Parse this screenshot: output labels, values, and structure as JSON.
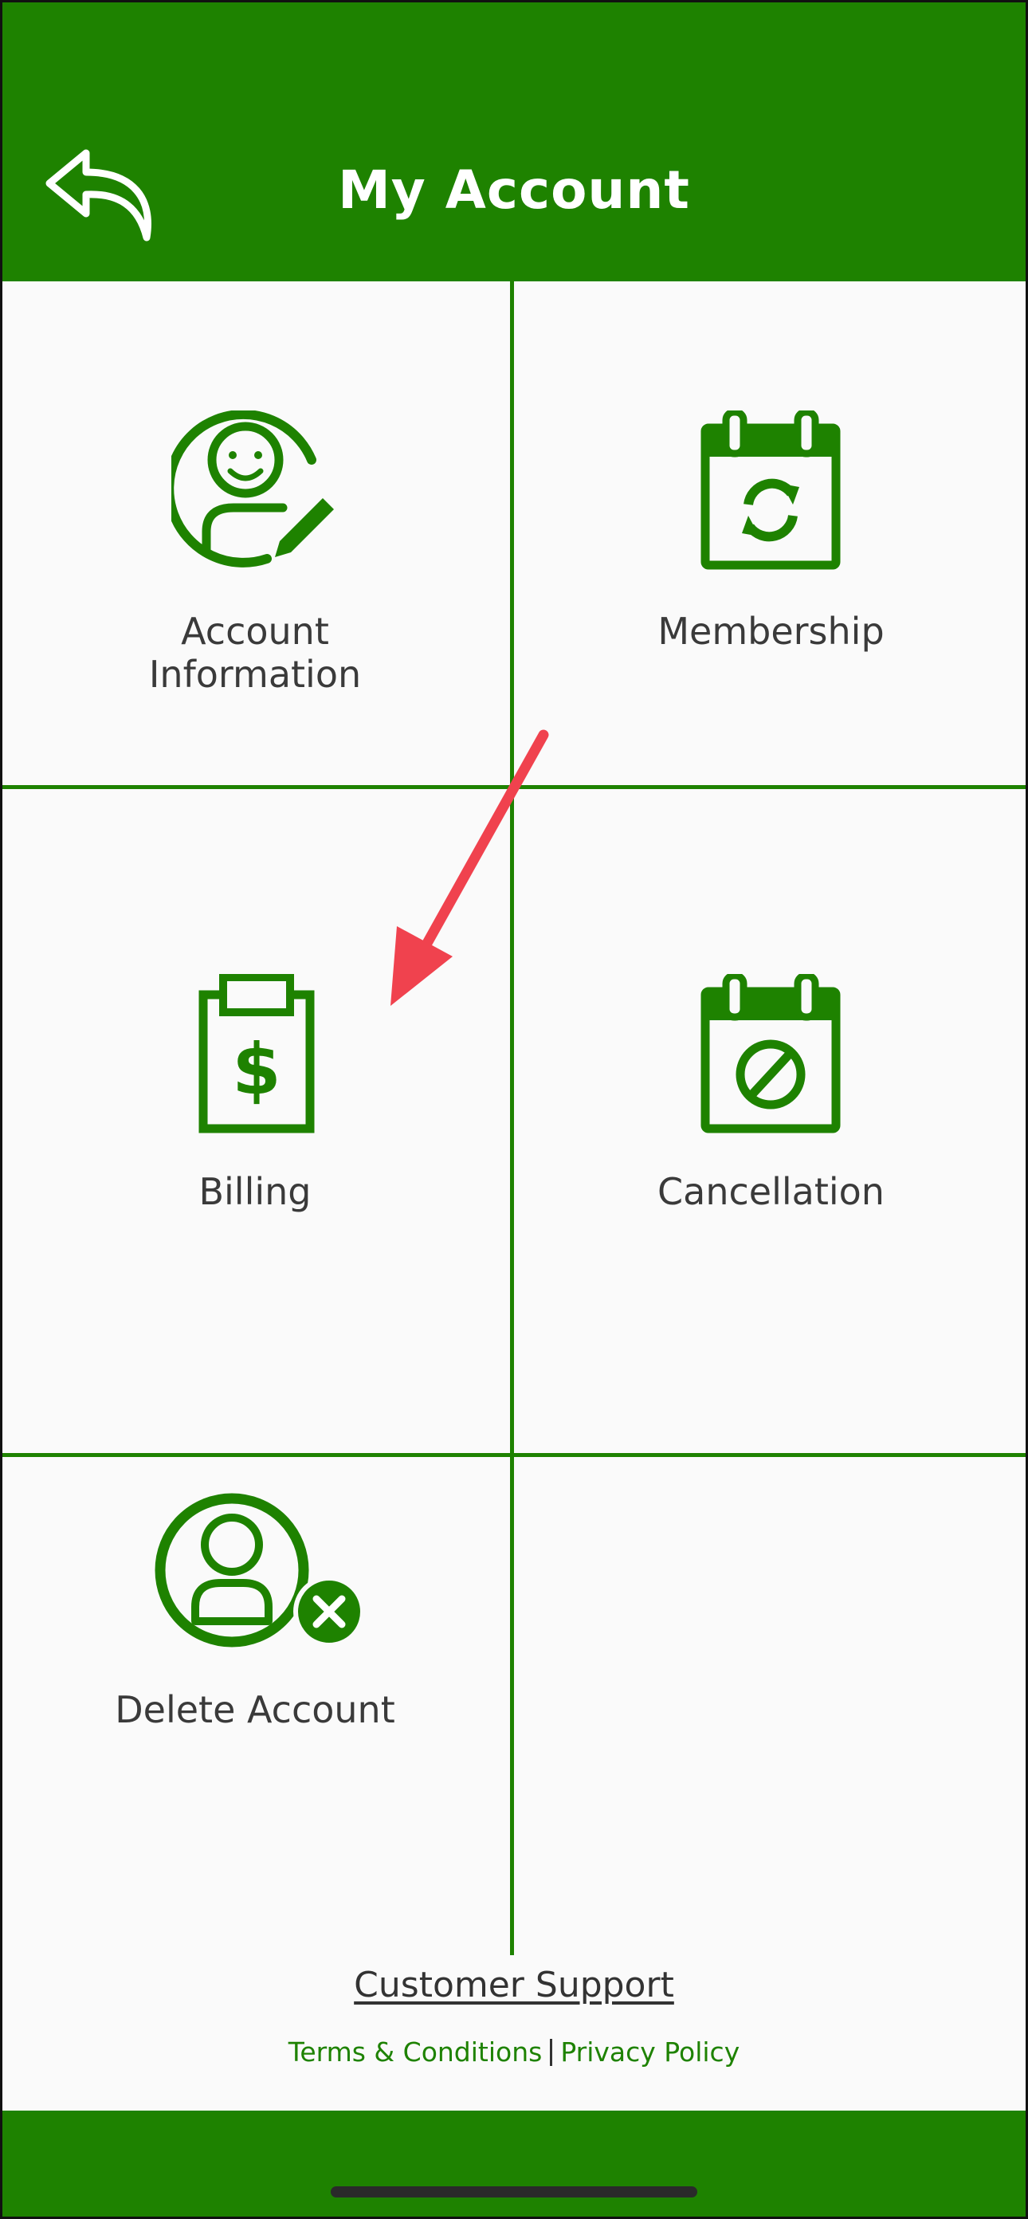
{
  "header": {
    "title": "My Account",
    "back_icon": "reply-arrow-icon",
    "background": "#1e8200"
  },
  "tiles": [
    {
      "id": "account-information",
      "label_line1": "Account",
      "label_line2": "Information",
      "icon": "user-edit-icon"
    },
    {
      "id": "membership",
      "label": "Membership",
      "icon": "calendar-refresh-icon"
    },
    {
      "id": "billing",
      "label": "Billing",
      "icon": "clipboard-dollar-icon"
    },
    {
      "id": "cancellation",
      "label": "Cancellation",
      "icon": "calendar-cancel-icon"
    },
    {
      "id": "delete-account",
      "label": "Delete Account",
      "icon": "user-delete-icon"
    }
  ],
  "links": {
    "customer_support": "Customer Support",
    "terms": "Terms & Conditions",
    "privacy": "Privacy Policy"
  },
  "colors": {
    "accent": "#1e8200",
    "background": "#fafafa",
    "text": "#3a3a3a",
    "annotation_arrow": "#f0424e"
  }
}
